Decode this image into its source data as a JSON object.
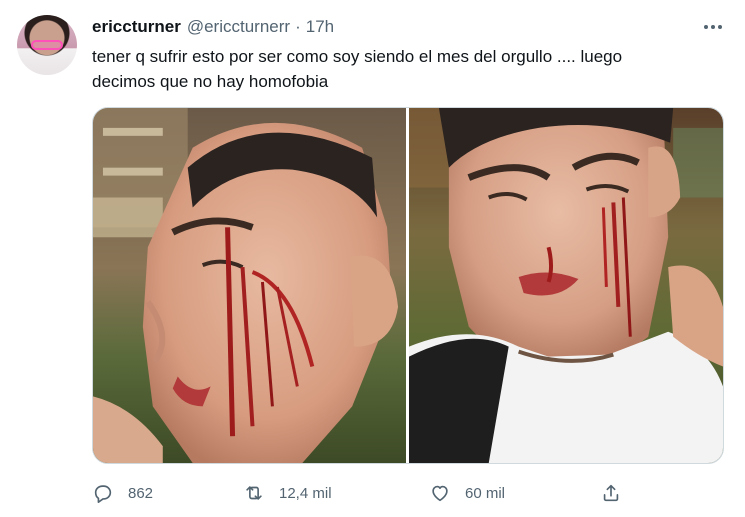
{
  "tweet": {
    "author_name": "ericcturner",
    "author_handle": "@ericcturnerr",
    "separator": "·",
    "timestamp": "17h",
    "text_lines": [
      "tener q sufrir esto por ser como soy siendo el mes del orgullo .... luego",
      "decimos que no hay homofobia"
    ]
  },
  "media": {
    "photos": [
      {
        "name": "photo-1"
      },
      {
        "name": "photo-2"
      }
    ]
  },
  "actions": {
    "replies": "862",
    "retweets": "12,4 mil",
    "likes": "60 mil"
  },
  "icons": {
    "more": "more-horizontal-icon",
    "reply": "reply-bubble-icon",
    "retweet": "retweet-icon",
    "like": "heart-icon",
    "share": "share-upload-icon"
  },
  "colors": {
    "text_primary": "#0f1419",
    "text_secondary": "#536471",
    "border": "#cfd9de"
  }
}
